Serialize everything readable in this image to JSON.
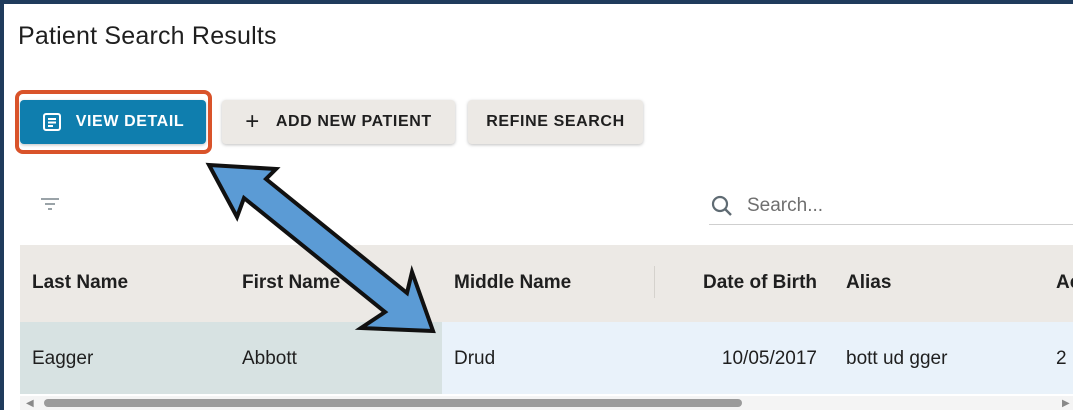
{
  "page": {
    "title": "Patient Search Results"
  },
  "toolbar": {
    "view_detail_label": "VIEW DETAIL",
    "add_patient_label": "ADD NEW PATIENT",
    "refine_label": "REFINE SEARCH"
  },
  "search": {
    "placeholder": "Search..."
  },
  "table": {
    "columns": [
      "Last Name",
      "First Name",
      "Middle Name",
      "Date of Birth",
      "Alias",
      "Ac"
    ],
    "rows": [
      [
        "Eagger",
        "Abbott",
        "Drud",
        "10/05/2017",
        "bott ud gger",
        "2"
      ]
    ]
  },
  "colors": {
    "primary": "#0f7eae",
    "highlight": "#d9532a",
    "annotation_arrow": "#5b9bd5",
    "header_bg": "#ece9e5",
    "row_bg": "#e9f2fa",
    "selected_cell_bg": "#d7e2e2",
    "frame": "#1f3b5c"
  },
  "icons": {
    "view_detail": "document-lines-icon",
    "add": "plus-icon",
    "filter": "filter-icon",
    "search": "search-icon"
  }
}
